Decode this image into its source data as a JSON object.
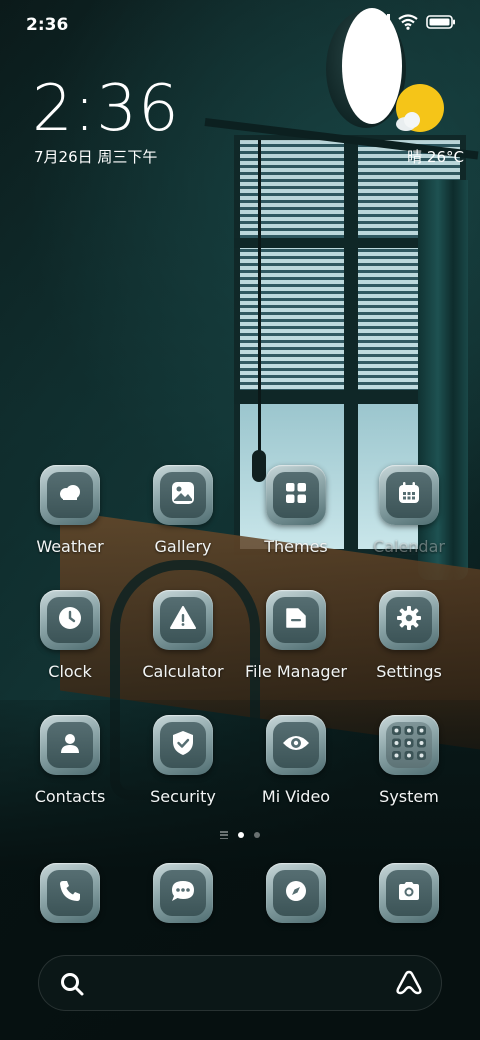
{
  "status_bar": {
    "time": "2:36"
  },
  "clock_widget": {
    "time": "2:36",
    "date": "7月26日 周三下午"
  },
  "weather_widget": {
    "text": "晴 26°C",
    "sun_color": "#F5C518"
  },
  "apps": [
    {
      "label": "Weather",
      "icon": "cloud-icon"
    },
    {
      "label": "Gallery",
      "icon": "image-icon"
    },
    {
      "label": "Themes",
      "icon": "grid-icon"
    },
    {
      "label": "Calendar",
      "icon": "calendar-icon"
    },
    {
      "label": "Clock",
      "icon": "clock-icon"
    },
    {
      "label": "Calculator",
      "icon": "warning-icon"
    },
    {
      "label": "File Manager",
      "icon": "folder-icon"
    },
    {
      "label": "Settings",
      "icon": "gear-icon"
    },
    {
      "label": "Contacts",
      "icon": "person-icon"
    },
    {
      "label": "Security",
      "icon": "shield-icon"
    },
    {
      "label": "Mi Video",
      "icon": "eye-icon"
    },
    {
      "label": "System",
      "icon": "folder-grid-icon"
    }
  ],
  "dock": [
    {
      "icon": "phone-icon"
    },
    {
      "icon": "message-icon"
    },
    {
      "icon": "compass-icon"
    },
    {
      "icon": "camera-icon"
    }
  ],
  "pages": {
    "count": 2,
    "active": 1
  },
  "search_bar": {
    "icon": "search-icon",
    "assistant_icon": "assistant-icon"
  },
  "colors": {
    "icon_tint": "#8EA7AA",
    "background": "#0C2222"
  }
}
